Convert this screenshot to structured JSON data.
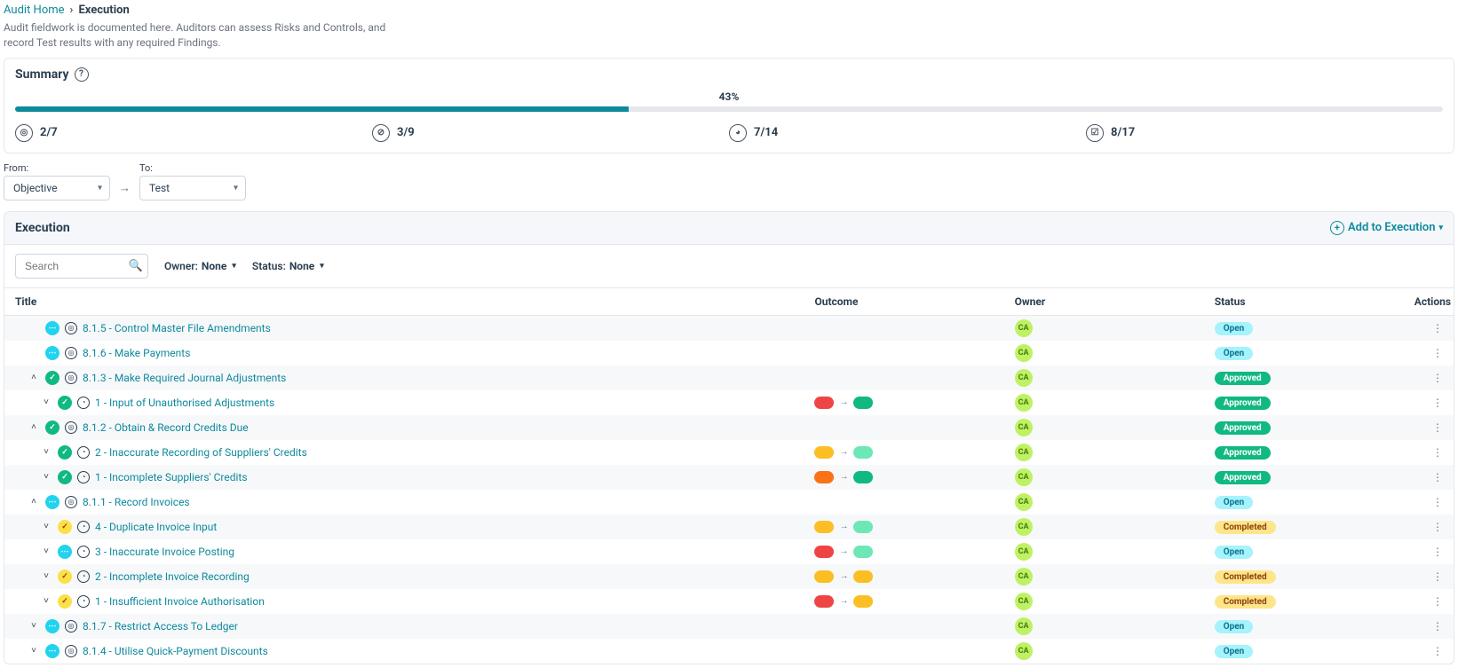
{
  "breadcrumb": {
    "home": "Audit Home",
    "sep": "›",
    "current": "Execution"
  },
  "description": "Audit fieldwork is documented here. Auditors can assess Risks and Controls, and record Test results with any required Findings.",
  "summary": {
    "title": "Summary",
    "percent_label": "43%",
    "percent": 43,
    "metrics": [
      {
        "icon": "◎",
        "value": "2/7"
      },
      {
        "icon": "⊘",
        "value": "3/9"
      },
      {
        "icon": "◕",
        "value": "7/14"
      },
      {
        "icon": "☑",
        "value": "8/17"
      }
    ]
  },
  "filters": {
    "from_label": "From:",
    "to_label": "To:",
    "from_value": "Objective",
    "to_value": "Test"
  },
  "execution": {
    "title": "Execution",
    "add_label": "Add to Execution",
    "search_placeholder": "Search",
    "owner_filter_label": "Owner:",
    "owner_filter_value": "None",
    "status_filter_label": "Status:",
    "status_filter_value": "None",
    "columns": {
      "title": "Title",
      "outcome": "Outcome",
      "owner": "Owner",
      "status": "Status",
      "actions": "Actions"
    },
    "rows": [
      {
        "level": 0,
        "expand": "",
        "state": "open",
        "type": "objective",
        "title": "8.1.5 - Control Master File Amendments",
        "outcome": null,
        "owner": "CA",
        "status": "Open"
      },
      {
        "level": 0,
        "expand": "",
        "state": "open",
        "type": "objective",
        "title": "8.1.6 - Make Payments",
        "outcome": null,
        "owner": "CA",
        "status": "Open"
      },
      {
        "level": 0,
        "expand": "up",
        "state": "approved",
        "type": "objective",
        "title": "8.1.3 - Make Required Journal Adjustments",
        "outcome": null,
        "owner": "CA",
        "status": "Approved"
      },
      {
        "level": 1,
        "expand": "dn",
        "state": "approved",
        "type": "risk",
        "title": "1 - Input of Unauthorised Adjustments",
        "outcome": [
          "red",
          "green"
        ],
        "owner": "CA",
        "status": "Approved"
      },
      {
        "level": 0,
        "expand": "up",
        "state": "approved",
        "type": "objective",
        "title": "8.1.2 - Obtain & Record Credits Due",
        "outcome": null,
        "owner": "CA",
        "status": "Approved"
      },
      {
        "level": 1,
        "expand": "dn",
        "state": "approved",
        "type": "risk",
        "title": "2 - Inaccurate Recording of Suppliers' Credits",
        "outcome": [
          "yellow",
          "lgreen"
        ],
        "owner": "CA",
        "status": "Approved"
      },
      {
        "level": 1,
        "expand": "dn",
        "state": "approved",
        "type": "risk",
        "title": "1 - Incomplete Suppliers' Credits",
        "outcome": [
          "orange",
          "green"
        ],
        "owner": "CA",
        "status": "Approved"
      },
      {
        "level": 0,
        "expand": "up",
        "state": "open",
        "type": "objective",
        "title": "8.1.1 - Record Invoices",
        "outcome": null,
        "owner": "CA",
        "status": "Open"
      },
      {
        "level": 1,
        "expand": "dn",
        "state": "completed",
        "type": "risk",
        "title": "4 - Duplicate Invoice Input",
        "outcome": [
          "yellow",
          "lgreen"
        ],
        "owner": "CA",
        "status": "Completed"
      },
      {
        "level": 1,
        "expand": "dn",
        "state": "open",
        "type": "risk",
        "title": "3 - Inaccurate Invoice Posting",
        "outcome": [
          "red",
          "lgreen"
        ],
        "owner": "CA",
        "status": "Open"
      },
      {
        "level": 1,
        "expand": "dn",
        "state": "completed",
        "type": "risk",
        "title": "2 - Incomplete Invoice Recording",
        "outcome": [
          "yellow",
          "yellow"
        ],
        "owner": "CA",
        "status": "Completed"
      },
      {
        "level": 1,
        "expand": "dn",
        "state": "completed",
        "type": "risk",
        "title": "1 - Insufficient Invoice Authorisation",
        "outcome": [
          "red",
          "yellow"
        ],
        "owner": "CA",
        "status": "Completed"
      },
      {
        "level": 0,
        "expand": "dn",
        "state": "open",
        "type": "objective",
        "title": "8.1.7 - Restrict Access To Ledger",
        "outcome": null,
        "owner": "CA",
        "status": "Open"
      },
      {
        "level": 0,
        "expand": "dn",
        "state": "open",
        "type": "objective",
        "title": "8.1.4 - Utilise Quick-Payment Discounts",
        "outcome": null,
        "owner": "CA",
        "status": "Open"
      }
    ]
  }
}
